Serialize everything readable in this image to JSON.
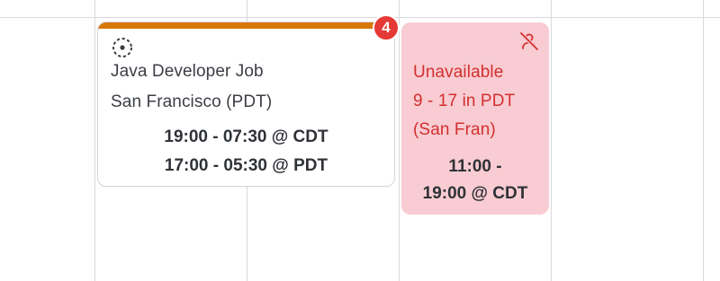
{
  "job_event": {
    "title": "Java Developer Job",
    "location": "San Francisco (PDT)",
    "time_line_1": "19:00 - 07:30 @ CDT",
    "time_line_2": "17:00 - 05:30 @ PDT",
    "status_icon": "dashed-circle-icon",
    "accent_color": "#d97706",
    "badge_count": "4",
    "badge_color": "#e53935"
  },
  "unavailable_event": {
    "line_1": "Unavailable",
    "line_2": "9 - 17 in PDT",
    "line_3": "(San Fran)",
    "time_line_1": "11:00 -",
    "time_line_2": "19:00 @ CDT",
    "icon": "user-off-icon",
    "background_color": "#f8ccd2",
    "text_color": "#d32f2f"
  }
}
